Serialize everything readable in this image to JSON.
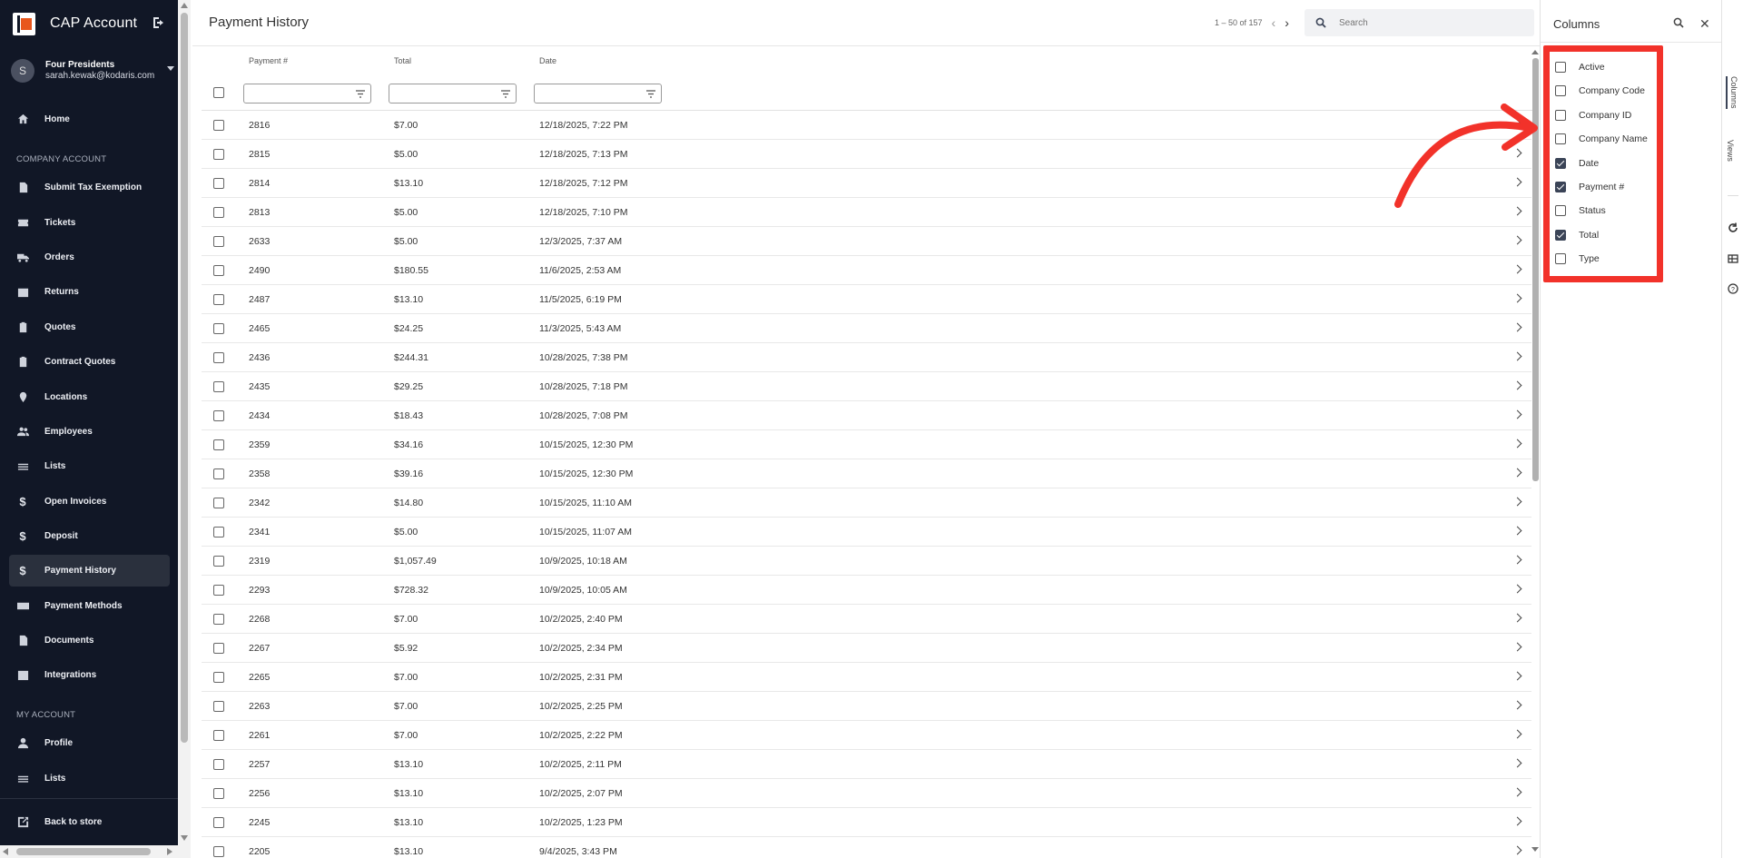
{
  "app": {
    "title": "CAP Account"
  },
  "user": {
    "initial": "S",
    "name": "Four Presidents",
    "email": "sarah.kewak@kodaris.com"
  },
  "sidebar": {
    "top_items": [
      {
        "label": "Home",
        "icon": "home-icon"
      }
    ],
    "company_section_label": "COMPANY ACCOUNT",
    "company_items": [
      {
        "label": "Submit Tax Exemption",
        "icon": "document-icon"
      },
      {
        "label": "Tickets",
        "icon": "ticket-icon"
      },
      {
        "label": "Orders",
        "icon": "truck-icon"
      },
      {
        "label": "Returns",
        "icon": "return-box-icon"
      },
      {
        "label": "Quotes",
        "icon": "clipboard-icon"
      },
      {
        "label": "Contract Quotes",
        "icon": "clipboard-icon"
      },
      {
        "label": "Locations",
        "icon": "location-pin-icon"
      },
      {
        "label": "Employees",
        "icon": "people-icon"
      },
      {
        "label": "Lists",
        "icon": "list-icon"
      },
      {
        "label": "Open Invoices",
        "icon": "dollar-icon"
      },
      {
        "label": "Deposit",
        "icon": "dollar-icon"
      },
      {
        "label": "Payment History",
        "icon": "dollar-icon",
        "active": true
      },
      {
        "label": "Payment Methods",
        "icon": "credit-card-icon"
      },
      {
        "label": "Documents",
        "icon": "document-icon"
      },
      {
        "label": "Integrations",
        "icon": "integration-icon"
      }
    ],
    "my_section_label": "MY ACCOUNT",
    "my_items": [
      {
        "label": "Profile",
        "icon": "person-icon"
      },
      {
        "label": "Lists",
        "icon": "list-icon"
      }
    ],
    "back_label": "Back to store"
  },
  "main": {
    "title": "Payment History",
    "pager": "1 – 50 of 157",
    "search_placeholder": "Search",
    "columns": [
      "Payment #",
      "Total",
      "Date"
    ],
    "rows": [
      [
        "2816",
        "$7.00",
        "12/18/2025, 7:22 PM"
      ],
      [
        "2815",
        "$5.00",
        "12/18/2025, 7:13 PM"
      ],
      [
        "2814",
        "$13.10",
        "12/18/2025, 7:12 PM"
      ],
      [
        "2813",
        "$5.00",
        "12/18/2025, 7:10 PM"
      ],
      [
        "2633",
        "$5.00",
        "12/3/2025, 7:37 AM"
      ],
      [
        "2490",
        "$180.55",
        "11/6/2025, 2:53 AM"
      ],
      [
        "2487",
        "$13.10",
        "11/5/2025, 6:19 PM"
      ],
      [
        "2465",
        "$24.25",
        "11/3/2025, 5:43 AM"
      ],
      [
        "2436",
        "$244.31",
        "10/28/2025, 7:38 PM"
      ],
      [
        "2435",
        "$29.25",
        "10/28/2025, 7:18 PM"
      ],
      [
        "2434",
        "$18.43",
        "10/28/2025, 7:08 PM"
      ],
      [
        "2359",
        "$34.16",
        "10/15/2025, 12:30 PM"
      ],
      [
        "2358",
        "$39.16",
        "10/15/2025, 12:30 PM"
      ],
      [
        "2342",
        "$14.80",
        "10/15/2025, 11:10 AM"
      ],
      [
        "2341",
        "$5.00",
        "10/15/2025, 11:07 AM"
      ],
      [
        "2319",
        "$1,057.49",
        "10/9/2025, 10:18 AM"
      ],
      [
        "2293",
        "$728.32",
        "10/9/2025, 10:05 AM"
      ],
      [
        "2268",
        "$7.00",
        "10/2/2025, 2:40 PM"
      ],
      [
        "2267",
        "$5.92",
        "10/2/2025, 2:34 PM"
      ],
      [
        "2265",
        "$7.00",
        "10/2/2025, 2:31 PM"
      ],
      [
        "2263",
        "$7.00",
        "10/2/2025, 2:25 PM"
      ],
      [
        "2261",
        "$7.00",
        "10/2/2025, 2:22 PM"
      ],
      [
        "2257",
        "$13.10",
        "10/2/2025, 2:11 PM"
      ],
      [
        "2256",
        "$13.10",
        "10/2/2025, 2:07 PM"
      ],
      [
        "2245",
        "$13.10",
        "10/2/2025, 1:23 PM"
      ],
      [
        "2205",
        "$13.10",
        "9/4/2025, 3:43 PM"
      ]
    ]
  },
  "columns_panel": {
    "title": "Columns",
    "options": [
      {
        "label": "Active",
        "checked": false
      },
      {
        "label": "Company Code",
        "checked": false
      },
      {
        "label": "Company ID",
        "checked": false
      },
      {
        "label": "Company Name",
        "checked": false
      },
      {
        "label": "Date",
        "checked": true
      },
      {
        "label": "Payment #",
        "checked": true
      },
      {
        "label": "Status",
        "checked": false
      },
      {
        "label": "Total",
        "checked": true
      },
      {
        "label": "Type",
        "checked": false
      }
    ]
  },
  "rail": {
    "tabs": [
      "Columns",
      "Views"
    ]
  },
  "colors": {
    "sidebar_bg": "#111726",
    "highlight": "#f2322a",
    "checkbox_checked": "#3b4457",
    "logo_accent": "#e8561c"
  }
}
